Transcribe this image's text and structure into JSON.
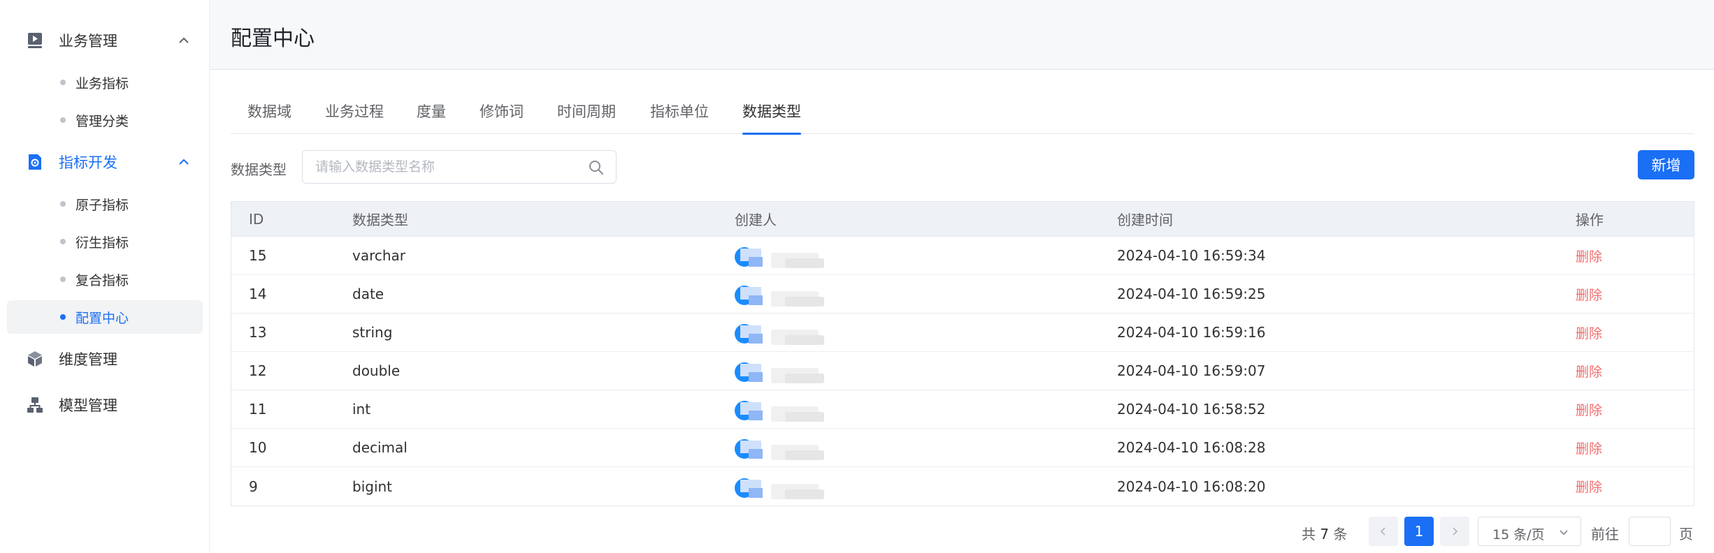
{
  "sidebar": {
    "groups": [
      {
        "label": "业务管理",
        "icon": "play-square-icon",
        "expanded": true,
        "items": [
          {
            "label": "业务指标"
          },
          {
            "label": "管理分类"
          }
        ]
      },
      {
        "label": "指标开发",
        "icon": "gear-document-icon",
        "expanded": true,
        "active": true,
        "items": [
          {
            "label": "原子指标"
          },
          {
            "label": "衍生指标"
          },
          {
            "label": "复合指标"
          },
          {
            "label": "配置中心",
            "selected": true
          }
        ]
      },
      {
        "label": "维度管理",
        "icon": "cube-icon"
      },
      {
        "label": "模型管理",
        "icon": "hierarchy-icon"
      }
    ]
  },
  "header": {
    "title": "配置中心"
  },
  "tabs": [
    {
      "label": "数据域"
    },
    {
      "label": "业务过程"
    },
    {
      "label": "度量"
    },
    {
      "label": "修饰词"
    },
    {
      "label": "时间周期"
    },
    {
      "label": "指标单位"
    },
    {
      "label": "数据类型",
      "active": true
    }
  ],
  "filter": {
    "label": "数据类型",
    "search_value": "",
    "search_placeholder": "请输入数据类型名称",
    "add_label": "新增"
  },
  "table": {
    "columns": [
      "ID",
      "数据类型",
      "创建人",
      "创建时间",
      "操作"
    ],
    "rows": [
      {
        "id": "15",
        "type": "varchar",
        "created_at": "2024-04-10 16:59:34",
        "action": "删除"
      },
      {
        "id": "14",
        "type": "date",
        "created_at": "2024-04-10 16:59:25",
        "action": "删除"
      },
      {
        "id": "13",
        "type": "string",
        "created_at": "2024-04-10 16:59:16",
        "action": "删除"
      },
      {
        "id": "12",
        "type": "double",
        "created_at": "2024-04-10 16:59:07",
        "action": "删除"
      },
      {
        "id": "11",
        "type": "int",
        "created_at": "2024-04-10 16:58:52",
        "action": "删除"
      },
      {
        "id": "10",
        "type": "decimal",
        "created_at": "2024-04-10 16:08:28",
        "action": "删除"
      },
      {
        "id": "9",
        "type": "bigint",
        "created_at": "2024-04-10 16:08:20",
        "action": "删除"
      }
    ]
  },
  "pagination": {
    "total_prefix": "共",
    "total_count": "7",
    "total_suffix": "条",
    "current_page": "1",
    "page_size": "15 条/页",
    "goto_label": "前往",
    "goto_value": "",
    "page_label": "页"
  },
  "colors": {
    "accent": "#1a6ff5",
    "danger": "#f56c6c",
    "header_bg": "#f7f8fa"
  }
}
